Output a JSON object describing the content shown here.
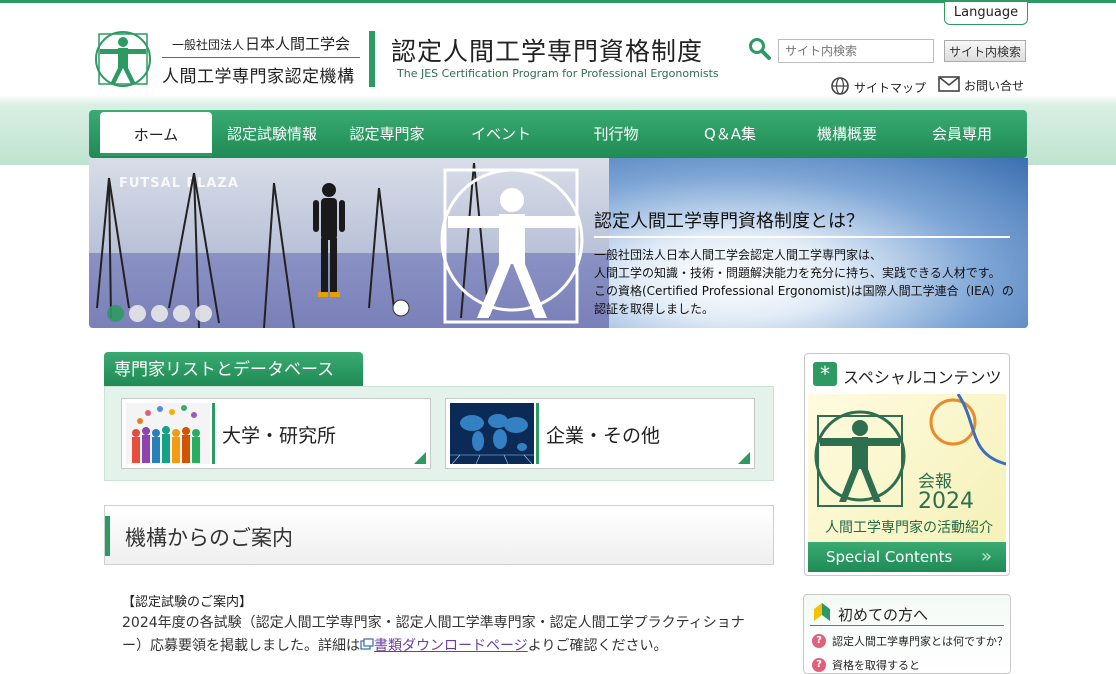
{
  "header": {
    "language_button": "Language",
    "org_subtitle": "一般社団法人",
    "org_name": "日本人間工学会",
    "org_title": "人間工学専門家認定機構",
    "site_title": "認定人間工学専門資格制度",
    "site_subtitle": "The JES Certification Program for Professional Ergonomists",
    "search": {
      "placeholder": "サイト内検索",
      "button": "サイト内検索"
    },
    "links": {
      "sitemap": "サイトマップ",
      "contact": "お問い合せ"
    }
  },
  "nav": {
    "items": [
      "ホーム",
      "認定試験情報",
      "認定専門家",
      "イベント",
      "刊行物",
      "Q＆A集",
      "機構概要",
      "会員専用"
    ],
    "active": "ホーム"
  },
  "hero": {
    "wall_text": "FUTSAL PLAZA",
    "title": "認定人間工学専門資格制度とは？",
    "text": [
      "一般社団法人日本人間工学会認定人間工学専門家は、",
      "人間工学の知識・技術・問題解決能力を充分に持ち、実践できる人材です。",
      "この資格(Certified Professional Ergonomist)は国際人間工学連合（IEA）の",
      "認証を取得しました。"
    ],
    "slides": 5,
    "active_slide": 1
  },
  "database": {
    "tab": "専門家リストとデータベース",
    "cards": [
      {
        "label": "大学・研究所",
        "thumb": "people-network"
      },
      {
        "label": "企業・その他",
        "thumb": "world-map"
      }
    ]
  },
  "info": {
    "title": "機構からのご案内",
    "notice_head": "【認定試験のご案内】",
    "notice_line1": "2024年度の各試験（認定人間工学専門家・認定人間工学準専門家・認定人間工学プラクティショナ",
    "notice_line2_pre": "ー）応募要領を掲載しました。詳細は",
    "notice_link": "書類ダウンロードページ",
    "notice_line2_post": "よりご確認ください。"
  },
  "special": {
    "heading": "スペシャルコンテンツ",
    "year_label": "会報",
    "year": "2024",
    "caption": "人間工学専門家の活動紹介",
    "footer": "Special Contents"
  },
  "beginner": {
    "heading": "初めての方へ",
    "items": [
      "認定人間工学専門家とは何ですか？",
      "資格を取得すると"
    ]
  },
  "colors": {
    "brand_green": "#2d9a63",
    "link_purple": "#6b3fa0"
  }
}
